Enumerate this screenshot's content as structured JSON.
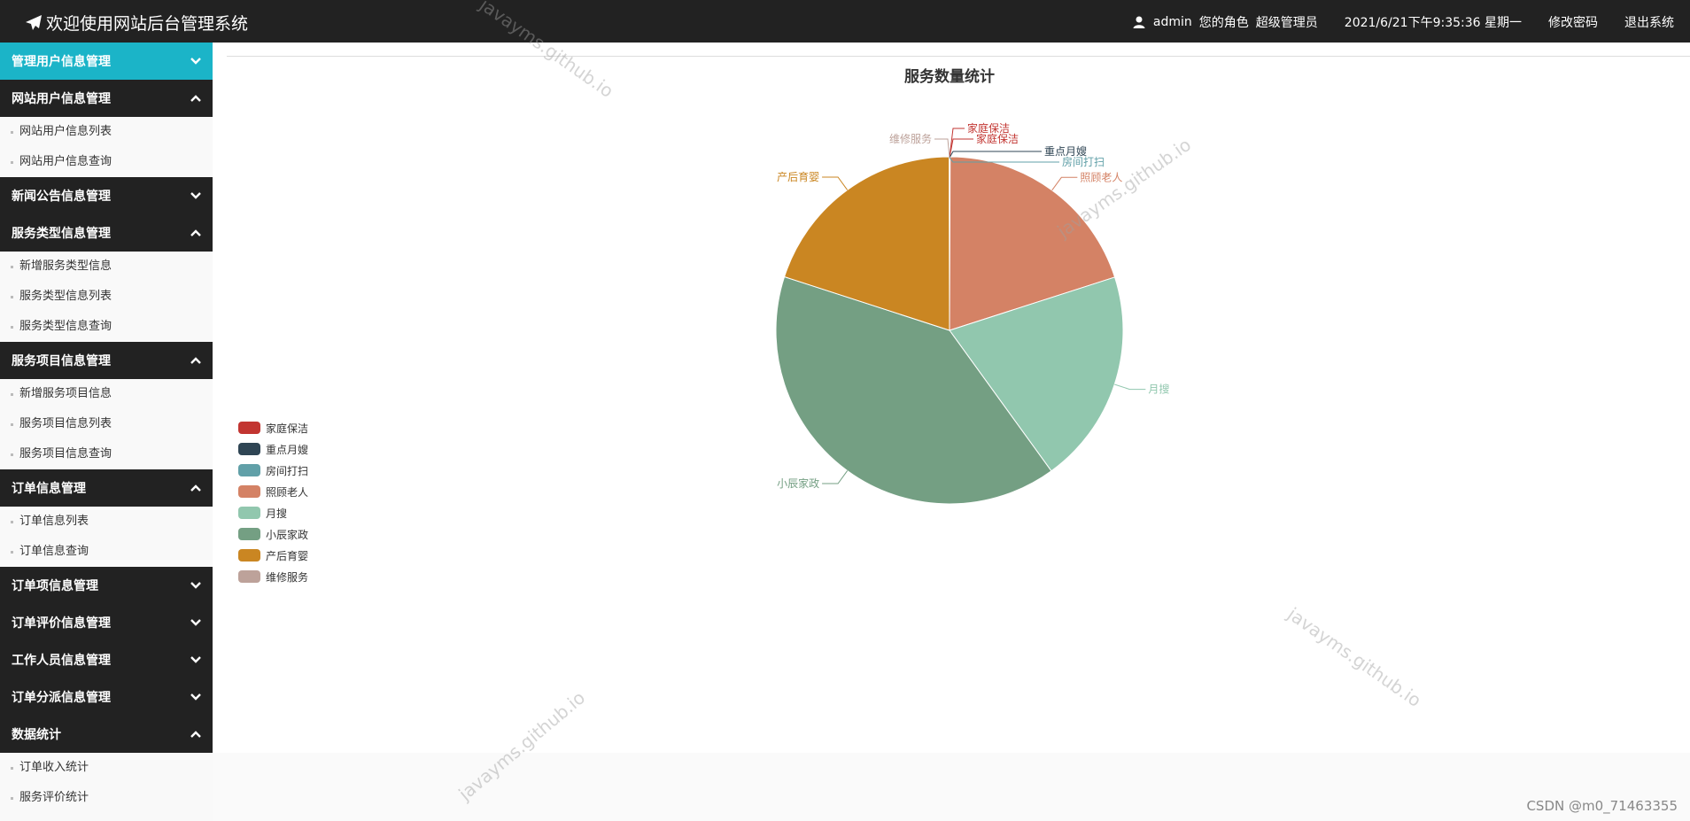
{
  "header": {
    "title": "欢迎使用网站后台管理系统",
    "username": "admin",
    "role_label": "您的角色",
    "role": "超级管理员",
    "datetime": "2021/6/21下午9:35:36 星期一",
    "change_password": "修改密码",
    "logout": "退出系统"
  },
  "sidebar": {
    "groups": [
      {
        "label": "管理用户信息管理",
        "expanded": false,
        "active": true,
        "items": []
      },
      {
        "label": "网站用户信息管理",
        "expanded": true,
        "active": false,
        "items": [
          "网站用户信息列表",
          "网站用户信息查询"
        ]
      },
      {
        "label": "新闻公告信息管理",
        "expanded": false,
        "active": false,
        "items": []
      },
      {
        "label": "服务类型信息管理",
        "expanded": true,
        "active": false,
        "items": [
          "新增服务类型信息",
          "服务类型信息列表",
          "服务类型信息查询"
        ]
      },
      {
        "label": "服务项目信息管理",
        "expanded": true,
        "active": false,
        "items": [
          "新增服务项目信息",
          "服务项目信息列表",
          "服务项目信息查询"
        ]
      },
      {
        "label": "订单信息管理",
        "expanded": true,
        "active": false,
        "items": [
          "订单信息列表",
          "订单信息查询"
        ]
      },
      {
        "label": "订单项信息管理",
        "expanded": false,
        "active": false,
        "items": []
      },
      {
        "label": "订单评价信息管理",
        "expanded": false,
        "active": false,
        "items": []
      },
      {
        "label": "工作人员信息管理",
        "expanded": false,
        "active": false,
        "items": []
      },
      {
        "label": "订单分派信息管理",
        "expanded": false,
        "active": false,
        "items": []
      },
      {
        "label": "数据统计",
        "expanded": true,
        "active": false,
        "items": [
          "订单收入统计",
          "服务评价统计"
        ]
      }
    ]
  },
  "chart_data": {
    "type": "pie",
    "title": "服务数量统计",
    "legend_position": "left",
    "slices": [
      {
        "name": "家庭保洁",
        "value": 0.001,
        "color": "#c23531"
      },
      {
        "name": "重点月嫂",
        "value": 0.001,
        "color": "#2f4554"
      },
      {
        "name": "房间打扫",
        "value": 0.001,
        "color": "#61a0a8"
      },
      {
        "name": "照顾老人",
        "value": 1,
        "color": "#d48265"
      },
      {
        "name": "月搜",
        "value": 1,
        "color": "#91c7ae"
      },
      {
        "name": "小辰家政",
        "value": 2,
        "color": "#749f83"
      },
      {
        "name": "产后育婴",
        "value": 1,
        "color": "#ca8622"
      },
      {
        "name": "维修服务",
        "value": 0.001,
        "color": "#bda29a"
      }
    ],
    "outer_labels": [
      "家庭保洁",
      "家庭保洁",
      "重点月嫂",
      "房间打扫",
      "照顾老人",
      "月搜",
      "小辰家政",
      "产后育婴",
      "维修服务"
    ]
  },
  "watermark": "javayms.github.io",
  "credit": "CSDN @m0_71463355"
}
